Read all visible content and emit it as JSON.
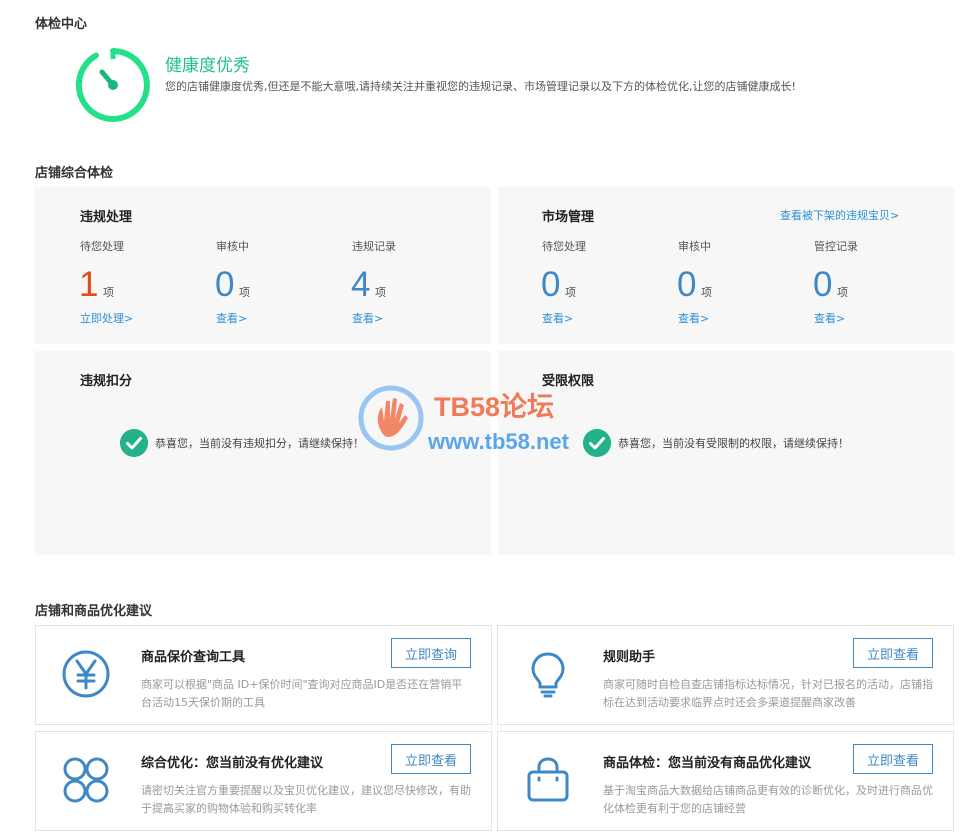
{
  "health": {
    "section_title": "体检中心",
    "status_title": "健康度优秀",
    "status_desc": "您的店铺健康度优秀,但还是不能大意哦,请持续关注并重视您的违规记录、市场管理记录以及下方的体检优化,让您的店铺健康成长!"
  },
  "overall": {
    "section_title": "店铺综合体检",
    "violations": {
      "title": "违规处理",
      "stats": [
        {
          "label": "待您处理",
          "value": "1",
          "unit": "项",
          "link": "立即处理>"
        },
        {
          "label": "审核中",
          "value": "0",
          "unit": "项",
          "link": "查看>"
        },
        {
          "label": "违规记录",
          "value": "4",
          "unit": "项",
          "link": "查看>"
        }
      ]
    },
    "market": {
      "title": "市场管理",
      "top_link": "查看被下架的违规宝贝>",
      "stats": [
        {
          "label": "待您处理",
          "value": "0",
          "unit": "项",
          "link": "查看>"
        },
        {
          "label": "审核中",
          "value": "0",
          "unit": "项",
          "link": "查看>"
        },
        {
          "label": "管控记录",
          "value": "0",
          "unit": "项",
          "link": "查看>"
        }
      ]
    },
    "deduction": {
      "title": "违规扣分",
      "message": "恭喜您，当前没有违规扣分，请继续保持！"
    },
    "restriction": {
      "title": "受限权限",
      "message": "恭喜您，当前没有受限制的权限，请继续保持！"
    }
  },
  "watermark": {
    "line1": "TB58论坛",
    "line2": "www.tb58.net"
  },
  "suggestions": {
    "section_title": "店铺和商品优化建议",
    "cards": [
      {
        "title": "商品保价查询工具",
        "button": "立即查询",
        "desc": "商家可以根据\"商品 ID+保价时间\"查询对应商品ID是否还在营销平台活动15天保价期的工具",
        "icon": "yen-icon"
      },
      {
        "title": "规则助手",
        "button": "立即查看",
        "desc": "商家可随时自检自查店铺指标达标情况，针对已报名的活动，店铺指标在达到活动要求临界点时还会多渠道提醒商家改善",
        "icon": "lightbulb-icon"
      },
      {
        "title": "综合优化：您当前没有优化建议",
        "button": "立即查看",
        "desc": "请密切关注官方重要提醒以及宝贝优化建议，建议您尽快修改，有助于提高买家的购物体验和购买转化率",
        "icon": "grid-circles-icon"
      },
      {
        "title": "商品体检：您当前没有商品优化建议",
        "button": "立即查看",
        "desc": "基于淘宝商品大数据给店铺商品更有效的诊断优化，及时进行商品优化体检更有利于您的店铺经营",
        "icon": "shopping-bag-icon"
      }
    ]
  },
  "colors": {
    "accent_green": "#1fbf8f",
    "alert_red": "#e4491c",
    "link_blue": "#2e8fd6"
  }
}
